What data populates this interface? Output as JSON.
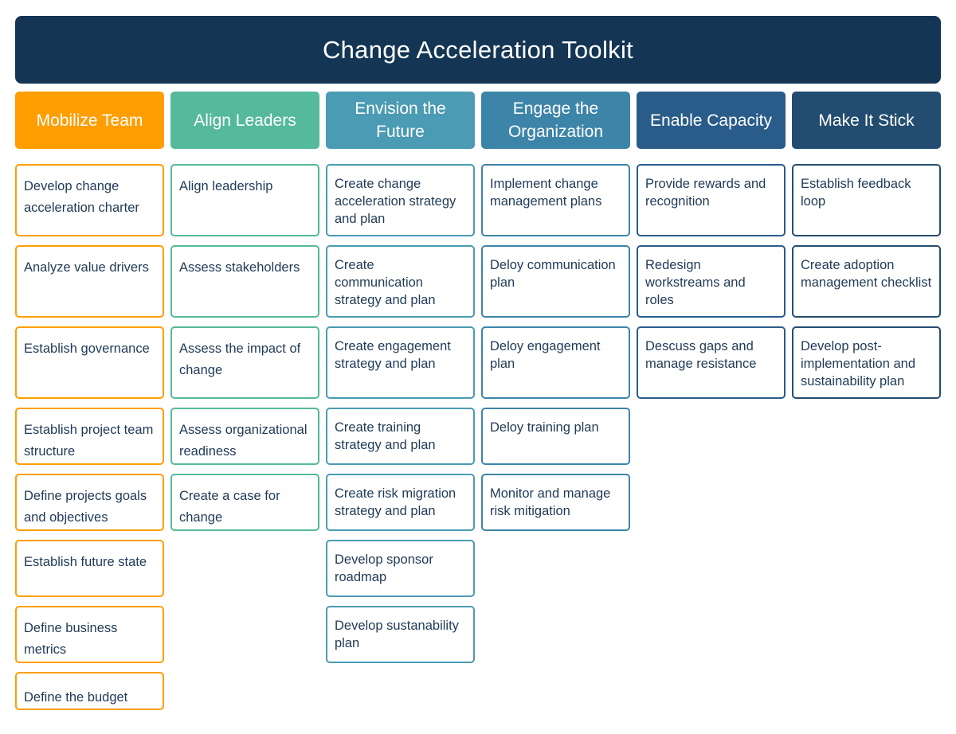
{
  "title": "Change Acceleration Toolkit",
  "columns": [
    {
      "header": "Mobilize Team",
      "color": "#FF9E00",
      "items": [
        "Develop change acceleration charter",
        "Analyze value drivers",
        "Establish governance",
        "Establish project team structure",
        "Define projects goals and objectives",
        "Establish future state",
        "Define business metrics",
        "Define the budget"
      ]
    },
    {
      "header": "Align Leaders",
      "color": "#55B99B",
      "items": [
        "Align leadership",
        "Assess stakeholders",
        "Assess the impact of change",
        "Assess organizational readiness",
        "Create a case for change"
      ]
    },
    {
      "header": "Envision the Future",
      "color": "#4A9BB3",
      "items": [
        "Create change acceleration strategy and plan",
        "Create communication strategy and plan",
        "Create engagement strategy and plan",
        "Create training strategy and plan",
        "Create risk migration strategy and plan",
        "Develop sponsor roadmap",
        "Develop sustanability plan"
      ]
    },
    {
      "header": "Engage the Organization",
      "color": "#3D85A8",
      "items": [
        "Implement change management plans",
        "Deloy communication plan",
        "Deloy engagement plan",
        "Deloy training plan",
        "Monitor and manage risk mitigation"
      ]
    },
    {
      "header": "Enable Capacity",
      "color": "#2A5C89",
      "items": [
        "Provide rewards and recognition",
        "Redesign workstreams and roles",
        "Descuss gaps and manage resistance"
      ]
    },
    {
      "header": "Make It Stick",
      "color": "#234D70",
      "items": [
        "Establish feedback loop",
        "Create adoption management checklist",
        "Develop post-implementation and sustainability plan"
      ]
    }
  ],
  "colors": {
    "title_background": "#143654",
    "card_text": "#1F3A56",
    "card_background": "#FFFFFF"
  }
}
